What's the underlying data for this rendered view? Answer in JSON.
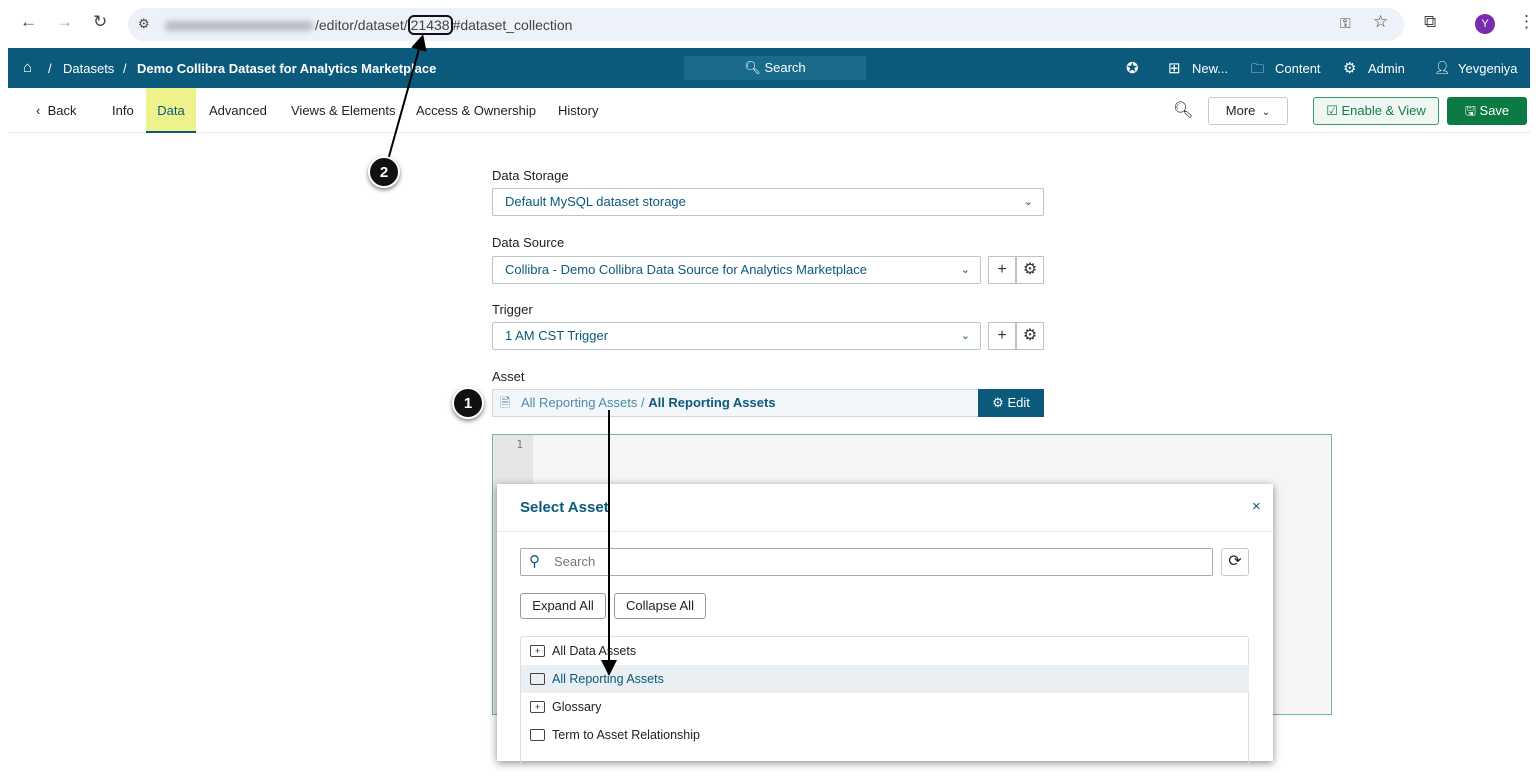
{
  "browser": {
    "url_path": "/editor/dataset/",
    "url_id": "21438",
    "url_hash": "#dataset_collection",
    "avatar": "Y"
  },
  "topnav": {
    "breadcrumb": [
      "Datasets",
      "Demo Collibra Dataset for Analytics Marketplace"
    ],
    "search": "Search",
    "new": "New...",
    "content": "Content",
    "admin": "Admin",
    "user": "Yevgeniya"
  },
  "tabs": {
    "back": "Back",
    "items": [
      "Info",
      "Data",
      "Advanced",
      "Views & Elements",
      "Access & Ownership",
      "History"
    ],
    "active": "Data",
    "more": "More",
    "enable_view": "Enable & View",
    "save": "Save"
  },
  "form": {
    "data_storage": {
      "label": "Data Storage",
      "value": "Default MySQL dataset storage"
    },
    "data_source": {
      "label": "Data Source",
      "value": "Collibra - Demo Collibra Data Source for Analytics Marketplace"
    },
    "trigger": {
      "label": "Trigger",
      "value": "1 AM CST Trigger"
    },
    "asset": {
      "label": "Asset",
      "path": "All Reporting Assets /",
      "name": "All Reporting Assets",
      "edit": "Edit"
    }
  },
  "editor": {
    "line": "1"
  },
  "modal": {
    "title": "Select Asset",
    "search_placeholder": "Search",
    "expand_all": "Expand All",
    "collapse_all": "Collapse All",
    "items": [
      {
        "label": "All Data Assets",
        "expandable": true
      },
      {
        "label": "All Reporting Assets",
        "expandable": false,
        "selected": true
      },
      {
        "label": "Glossary",
        "expandable": true
      },
      {
        "label": "Term to Asset Relationship",
        "expandable": false
      }
    ]
  },
  "annotations": {
    "one": "1",
    "two": "2"
  }
}
